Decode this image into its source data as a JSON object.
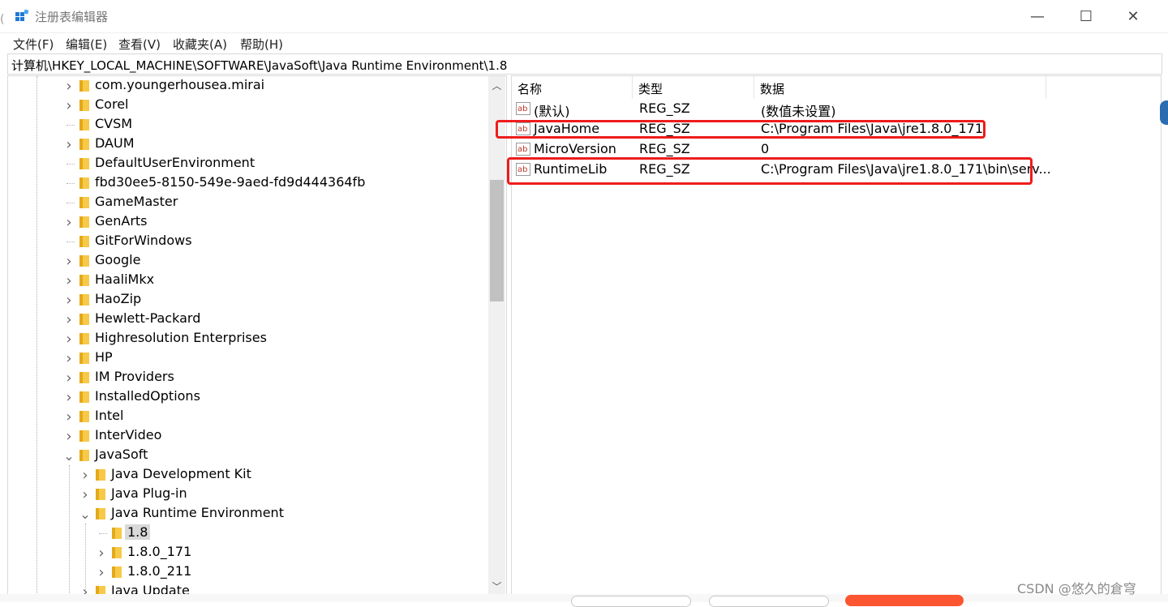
{
  "window": {
    "title": "注册表编辑器",
    "minimize": "—",
    "maximize": "☐",
    "close": "✕"
  },
  "menu": [
    "文件(F)",
    "编辑(E)",
    "查看(V)",
    "收藏夹(A)",
    "帮助(H)"
  ],
  "address": "计算机\\HKEY_LOCAL_MACHINE\\SOFTWARE\\JavaSoft\\Java Runtime Environment\\1.8",
  "tree": [
    {
      "label": "com.youngerhousea.mirai",
      "expander": ">"
    },
    {
      "label": "Corel",
      "expander": ">"
    },
    {
      "label": "CVSM",
      "expander": ""
    },
    {
      "label": "DAUM",
      "expander": ">"
    },
    {
      "label": "DefaultUserEnvironment",
      "expander": ""
    },
    {
      "label": "fbd30ee5-8150-549e-9aed-fd9d444364fb",
      "expander": ""
    },
    {
      "label": "GameMaster",
      "expander": ""
    },
    {
      "label": "GenArts",
      "expander": ">"
    },
    {
      "label": "GitForWindows",
      "expander": ""
    },
    {
      "label": "Google",
      "expander": ">"
    },
    {
      "label": "HaaliMkx",
      "expander": ">"
    },
    {
      "label": "HaoZip",
      "expander": ">"
    },
    {
      "label": "Hewlett-Packard",
      "expander": ">"
    },
    {
      "label": "Highresolution Enterprises",
      "expander": ">"
    },
    {
      "label": "HP",
      "expander": ">"
    },
    {
      "label": "IM Providers",
      "expander": ">"
    },
    {
      "label": "InstalledOptions",
      "expander": ">"
    },
    {
      "label": "Intel",
      "expander": ">"
    },
    {
      "label": "InterVideo",
      "expander": ">"
    },
    {
      "label": "JavaSoft",
      "expander": "v"
    },
    {
      "label": "Java Development Kit",
      "expander": ">"
    },
    {
      "label": "Java Plug-in",
      "expander": ">"
    },
    {
      "label": "Java Runtime Environment",
      "expander": "v"
    },
    {
      "label": "1.8",
      "expander": ""
    },
    {
      "label": "1.8.0_171",
      "expander": ">"
    },
    {
      "label": "1.8.0_211",
      "expander": ">"
    },
    {
      "label": "Java Update",
      "expander": ">"
    }
  ],
  "columns": {
    "name": "名称",
    "type": "类型",
    "data": "数据"
  },
  "values": [
    {
      "name": "(默认)",
      "type": "REG_SZ",
      "data": "(数值未设置)"
    },
    {
      "name": "JavaHome",
      "type": "REG_SZ",
      "data": "C:\\Program Files\\Java\\jre1.8.0_171"
    },
    {
      "name": "MicroVersion",
      "type": "REG_SZ",
      "data": "0"
    },
    {
      "name": "RuntimeLib",
      "type": "REG_SZ",
      "data": "C:\\Program Files\\Java\\jre1.8.0_171\\bin\\serv..."
    }
  ],
  "watermark": "CSDN @悠久的倉穹",
  "colors": {
    "highlight": "#ee1c1c",
    "folder": "#f7c948",
    "selection": "#d9d9d9"
  }
}
